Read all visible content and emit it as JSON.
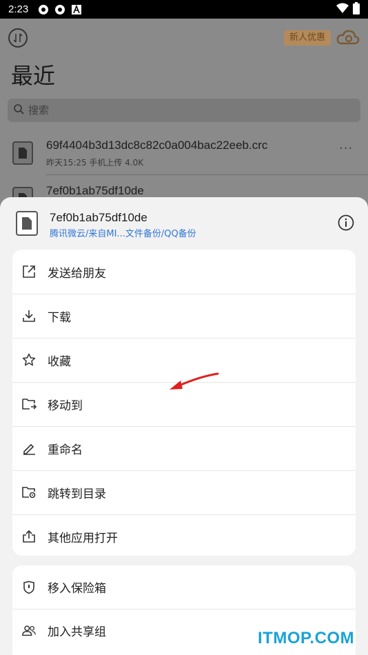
{
  "status_bar": {
    "time": "2:23",
    "icons": [
      "settings-gear-icon",
      "settings-gear-icon",
      "text-a-icon"
    ],
    "right_icons": [
      "wifi-icon",
      "battery-icon"
    ]
  },
  "background": {
    "promo_badge": "新人优惠",
    "page_title": "最近",
    "search": {
      "placeholder": "搜索"
    },
    "files": [
      {
        "name": "69f4404b3d13dc8c82c0a004bac22eeb.crc",
        "meta": "昨天15:25  手机上传  4.0K"
      },
      {
        "name": "7ef0b1ab75df10de",
        "meta": ""
      }
    ]
  },
  "sheet": {
    "file_name": "7ef0b1ab75df10de",
    "file_path": "腾讯微云/来自MI...文件备份/QQ备份",
    "menu_primary": [
      {
        "label": "发送给朋友",
        "icon": "share-external-icon"
      },
      {
        "label": "下载",
        "icon": "download-icon"
      },
      {
        "label": "收藏",
        "icon": "star-icon"
      },
      {
        "label": "移动到",
        "icon": "folder-move-icon"
      },
      {
        "label": "重命名",
        "icon": "pencil-icon"
      },
      {
        "label": "跳转到目录",
        "icon": "folder-locate-icon"
      },
      {
        "label": "其他应用打开",
        "icon": "open-with-icon"
      }
    ],
    "menu_secondary": [
      {
        "label": "移入保险箱",
        "icon": "shield-icon"
      },
      {
        "label": "加入共享组",
        "icon": "group-icon"
      }
    ]
  },
  "annotation_color": "#e02020",
  "watermark": "ITMOP.COM"
}
